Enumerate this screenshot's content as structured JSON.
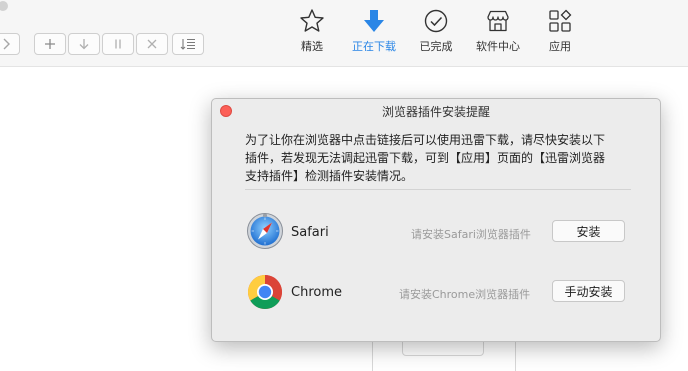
{
  "toolbar": {
    "nav": [
      {
        "label": "精选",
        "icon": "star-icon",
        "active": false
      },
      {
        "label": "正在下载",
        "icon": "download-arrow-icon",
        "active": true
      },
      {
        "label": "已完成",
        "icon": "check-circle-icon",
        "active": false
      },
      {
        "label": "软件中心",
        "icon": "store-icon",
        "active": false
      },
      {
        "label": "应用",
        "icon": "apps-grid-icon",
        "active": false
      }
    ],
    "buttons": [
      "chevron-right-icon",
      "plus-icon",
      "arrow-down-icon",
      "pause-icon",
      "close-icon",
      "sort-list-icon"
    ]
  },
  "dialog": {
    "title": "浏览器插件安装提醒",
    "description_lines": [
      "为了让你在浏览器中点击链接后可以使用迅雷下载，请尽快安装以下",
      "插件，若发现无法调起迅雷下载，可到【应用】页面的【迅雷浏览器",
      "支持插件】检测插件安装情况。"
    ],
    "browsers": [
      {
        "name": "Safari",
        "hint": "请安装Safari浏览器插件",
        "button": "安装",
        "icon": "safari-compass-icon"
      },
      {
        "name": "Chrome",
        "hint": "请安装Chrome浏览器插件",
        "button": "手动安装",
        "icon": "chrome-logo-icon"
      }
    ]
  },
  "colors": {
    "accent": "#2a86e6",
    "close": "#fc5f57"
  }
}
